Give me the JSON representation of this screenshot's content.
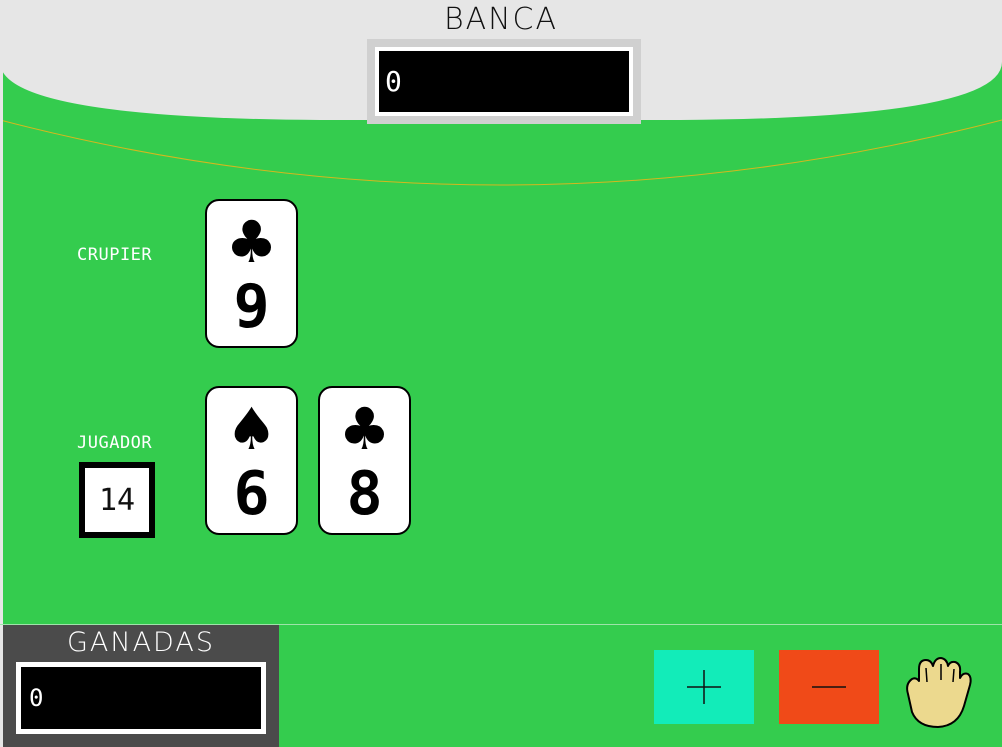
{
  "banca": {
    "title": "BANCA",
    "value": "0"
  },
  "crupier": {
    "label": "CRUPIER",
    "cards": [
      {
        "suit_icon": "club",
        "suit_glyph": "♣",
        "rank": "9"
      }
    ]
  },
  "jugador": {
    "label": "JUGADOR",
    "score": "14",
    "cards": [
      {
        "suit_icon": "spade",
        "suit_glyph": "♠",
        "rank": "6"
      },
      {
        "suit_icon": "club",
        "suit_glyph": "♣",
        "rank": "8"
      }
    ]
  },
  "ganadas": {
    "title": "GANADAS",
    "value": "0"
  },
  "controls": {
    "hit_icon": "plus-icon",
    "decrease_icon": "minus-icon",
    "stand_icon": "hand-icon"
  },
  "colors": {
    "felt": "#34cc4e",
    "dealer_area": "#e6e6e6",
    "arc_line": "#d4b81e",
    "hit_button": "#12ecb9",
    "minus_button": "#f04a18",
    "panel": "#4b4b4b",
    "hand": "#ecd98e"
  }
}
